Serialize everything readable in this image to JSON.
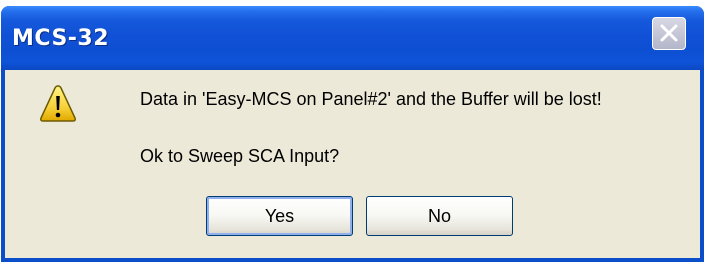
{
  "window": {
    "title": "MCS-32"
  },
  "message": {
    "line1": "Data in 'Easy-MCS on Panel#2' and the Buffer will be lost!",
    "line2": "Ok to Sweep SCA Input?",
    "icon": "warning-icon"
  },
  "buttons": {
    "yes_label": "Yes",
    "no_label": "No"
  },
  "colors": {
    "titlebar": "#0d4fd2",
    "client_background": "#ece9d8",
    "warning_yellow": "#f8d23a"
  }
}
